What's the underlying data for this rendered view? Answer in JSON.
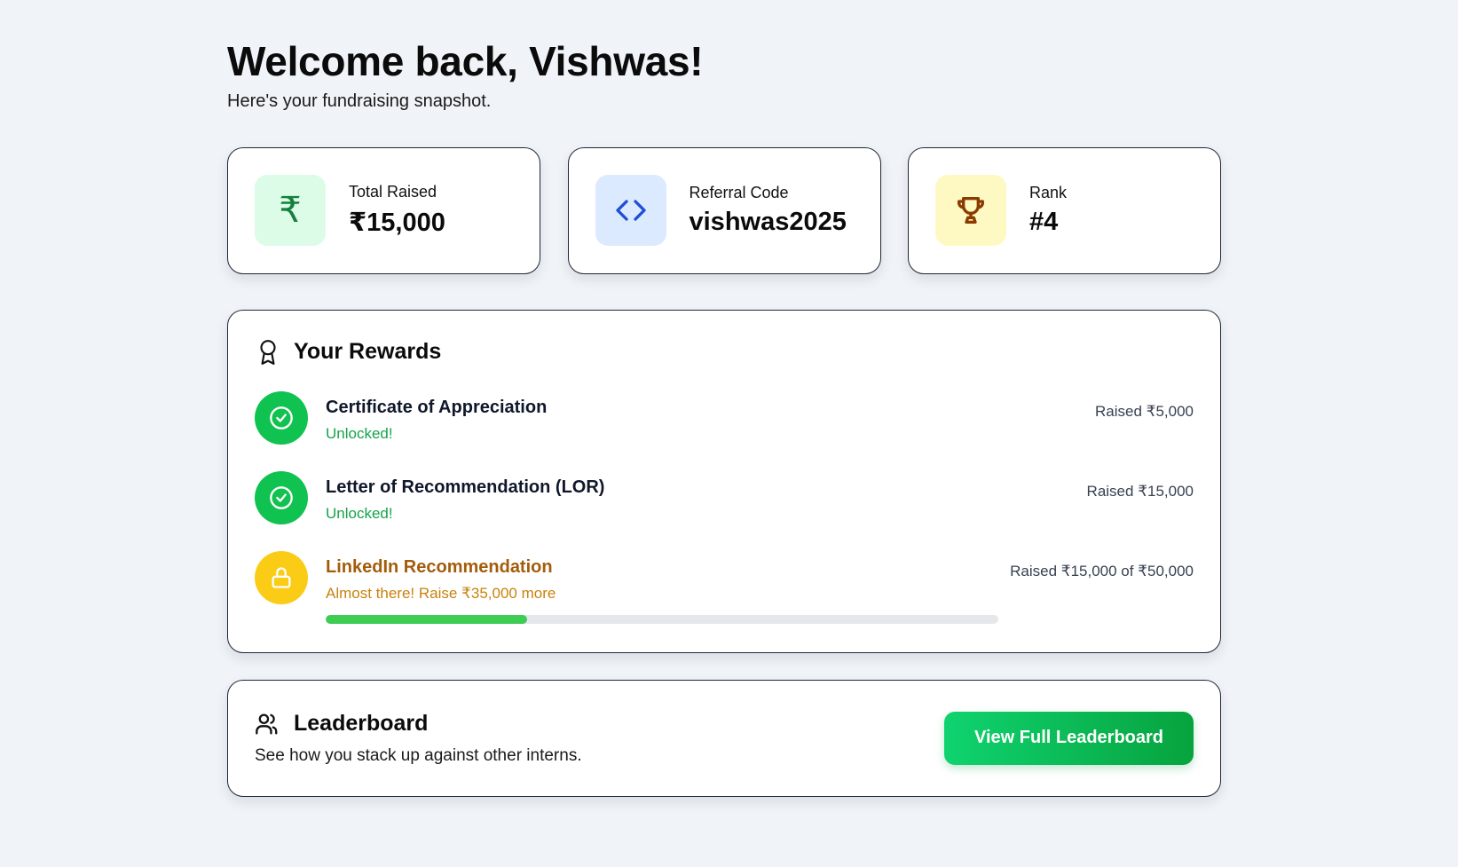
{
  "header": {
    "title": "Welcome back, Vishwas!",
    "subtitle": "Here's your fundraising snapshot."
  },
  "stats": [
    {
      "label": "Total Raised",
      "value": "₹15,000",
      "icon": "rupee-icon",
      "icon_glyph": "₹",
      "accent": "#15803d",
      "bg": "#dcfce7"
    },
    {
      "label": "Referral Code",
      "value": "vishwas2025",
      "icon": "code-icon",
      "accent": "#1d4ed8",
      "bg": "#dbeafe"
    },
    {
      "label": "Rank",
      "value": "#4",
      "icon": "trophy-icon",
      "accent": "#8a3c00",
      "bg": "#fef9c3"
    }
  ],
  "rewards": {
    "title": "Your Rewards",
    "icon": "award-icon",
    "items": [
      {
        "name": "Certificate of Appreciation",
        "status": "Unlocked!",
        "raised": "Raised ₹5,000",
        "state": "unlocked",
        "icon": "check-circle-icon"
      },
      {
        "name": "Letter of Recommendation (LOR)",
        "status": "Unlocked!",
        "raised": "Raised ₹15,000",
        "state": "unlocked",
        "icon": "check-circle-icon"
      },
      {
        "name": "LinkedIn Recommendation",
        "status": "Almost there! Raise ₹35,000 more",
        "raised": "Raised ₹15,000 of ₹50,000",
        "state": "locked",
        "icon": "lock-icon",
        "progress": 0.3
      }
    ]
  },
  "leaderboard": {
    "title": "Leaderboard",
    "icon": "users-icon",
    "description": "See how you stack up against other interns.",
    "button_label": "View Full Leaderboard"
  },
  "colors": {
    "background": "#f0f4f8",
    "success": "#10c250",
    "warning": "#facc15",
    "progress": "#3fcc55",
    "button_start": "#0fd36f",
    "button_end": "#07a33e"
  }
}
